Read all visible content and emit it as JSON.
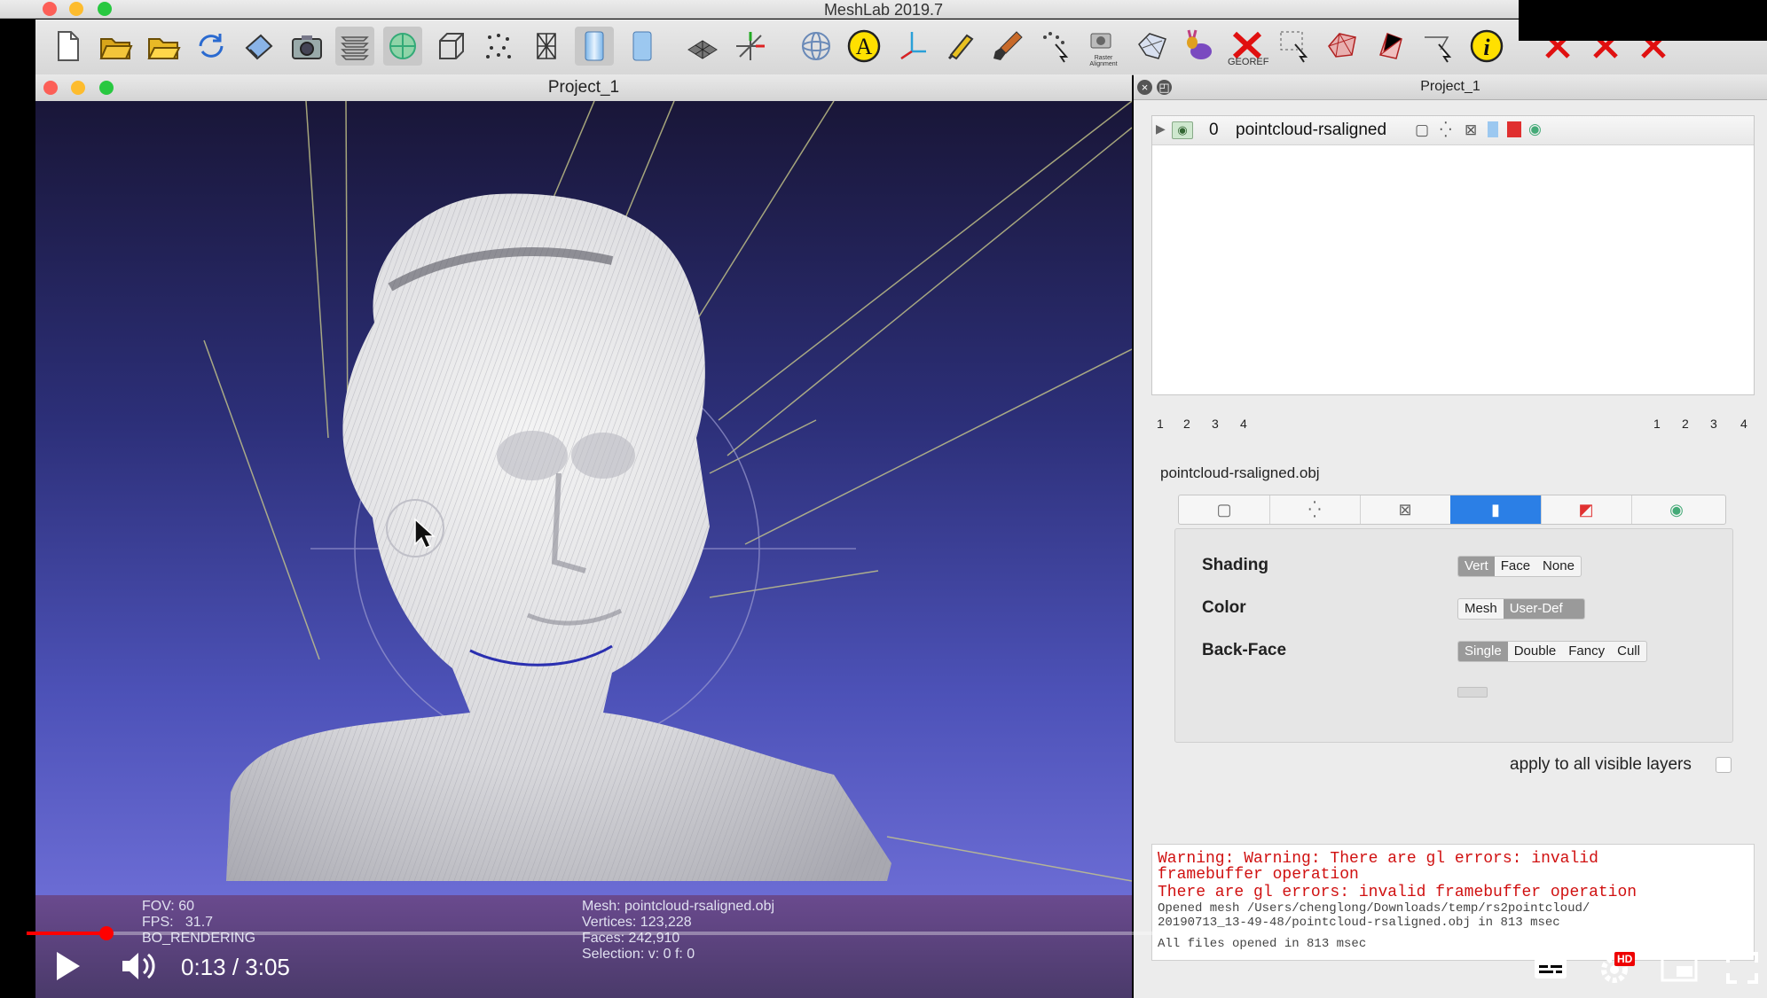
{
  "app": {
    "title": "MeshLab 2019.7"
  },
  "toolbar": {
    "items": [
      {
        "name": "new-project-icon"
      },
      {
        "name": "open-project-icon"
      },
      {
        "name": "import-mesh-icon"
      },
      {
        "name": "reload-icon"
      },
      {
        "name": "save-icon"
      },
      {
        "name": "snapshot-icon"
      },
      {
        "name": "layers-icon"
      },
      {
        "name": "raster-icon"
      },
      {
        "name": "bbox-icon"
      },
      {
        "name": "points-icon"
      },
      {
        "name": "wireframe-icon"
      },
      {
        "name": "smooth-shading-icon"
      },
      {
        "name": "flat-shading-icon"
      },
      {
        "name": "grid-icon"
      },
      {
        "name": "axis-icon"
      },
      {
        "name": "trackball-icon"
      },
      {
        "name": "annotation-icon"
      },
      {
        "name": "measure-icon"
      },
      {
        "name": "pick-points-icon"
      },
      {
        "name": "paint-icon"
      },
      {
        "name": "align-icon"
      },
      {
        "name": "raster-alignment-icon"
      },
      {
        "name": "bunny-icon"
      },
      {
        "name": "georef-icon"
      },
      {
        "name": "select-vertices-icon"
      },
      {
        "name": "select-faces-icon"
      },
      {
        "name": "select-connected-icon"
      },
      {
        "name": "select-region-icon"
      },
      {
        "name": "info-icon"
      },
      {
        "name": "delete-vertices-icon"
      },
      {
        "name": "delete-faces-icon"
      },
      {
        "name": "delete-selection-icon"
      }
    ],
    "raster_alignment_label": "Raster\nAlignment",
    "georef_label": "GEOREF"
  },
  "left_window": {
    "title": "Project_1"
  },
  "viewport_info": {
    "fov": "FOV: 60",
    "fps": "FPS:   31.7",
    "rendering": "BO_RENDERING",
    "mesh": "Mesh: pointcloud-rsaligned.obj",
    "vertices": "Vertices: 123,228",
    "faces": "Faces: 242,910",
    "selection": "Selection: v: 0 f: 0"
  },
  "right_panel": {
    "title": "Project_1",
    "layer": {
      "index": "0",
      "name": "pointcloud-rsaligned"
    },
    "pages_left": [
      "1",
      "2",
      "3",
      "4"
    ],
    "pages_right": [
      "1",
      "2",
      "3",
      "4"
    ],
    "file_label": "pointcloud-rsaligned.obj",
    "tabs": [
      {
        "name": "bbox-tab-icon",
        "glyph": "▢"
      },
      {
        "name": "points-tab-icon",
        "glyph": "⁛"
      },
      {
        "name": "wire-tab-icon",
        "glyph": "⊠"
      },
      {
        "name": "fill-tab-icon",
        "glyph": "▮"
      },
      {
        "name": "texture-tab-icon",
        "glyph": "◩"
      },
      {
        "name": "select-tab-icon",
        "glyph": "◉"
      }
    ],
    "shading": {
      "label": "Shading",
      "options": [
        "Vert",
        "Face",
        "None"
      ],
      "selected": "Vert"
    },
    "color": {
      "label": "Color",
      "options": [
        "Mesh",
        "User-Def"
      ],
      "selected": "User-Def"
    },
    "backface": {
      "label": "Back-Face",
      "options": [
        "Single",
        "Double",
        "Fancy",
        "Cull"
      ],
      "selected": "Single"
    },
    "apply_label": "apply to all visible layers"
  },
  "log": {
    "lines": [
      {
        "text": "Warning: Warning: There are gl errors: invalid",
        "color": "#d01010"
      },
      {
        "text": "framebuffer operation",
        "color": "#d01010"
      },
      {
        "text": "There are gl errors: invalid framebuffer operation",
        "color": "#d01010"
      },
      {
        "text": "Opened mesh /Users/chenglong/Downloads/temp/rs2pointcloud/",
        "color": "#444444"
      },
      {
        "text": "20190713_13-49-48/pointcloud-rsaligned.obj in 813 msec",
        "color": "#444444"
      },
      {
        "text": "All files opened in 813 msec",
        "color": "#444444"
      }
    ]
  },
  "video": {
    "time": "0:13 / 3:05",
    "progress": 0.07,
    "hd_badge": "HD"
  }
}
